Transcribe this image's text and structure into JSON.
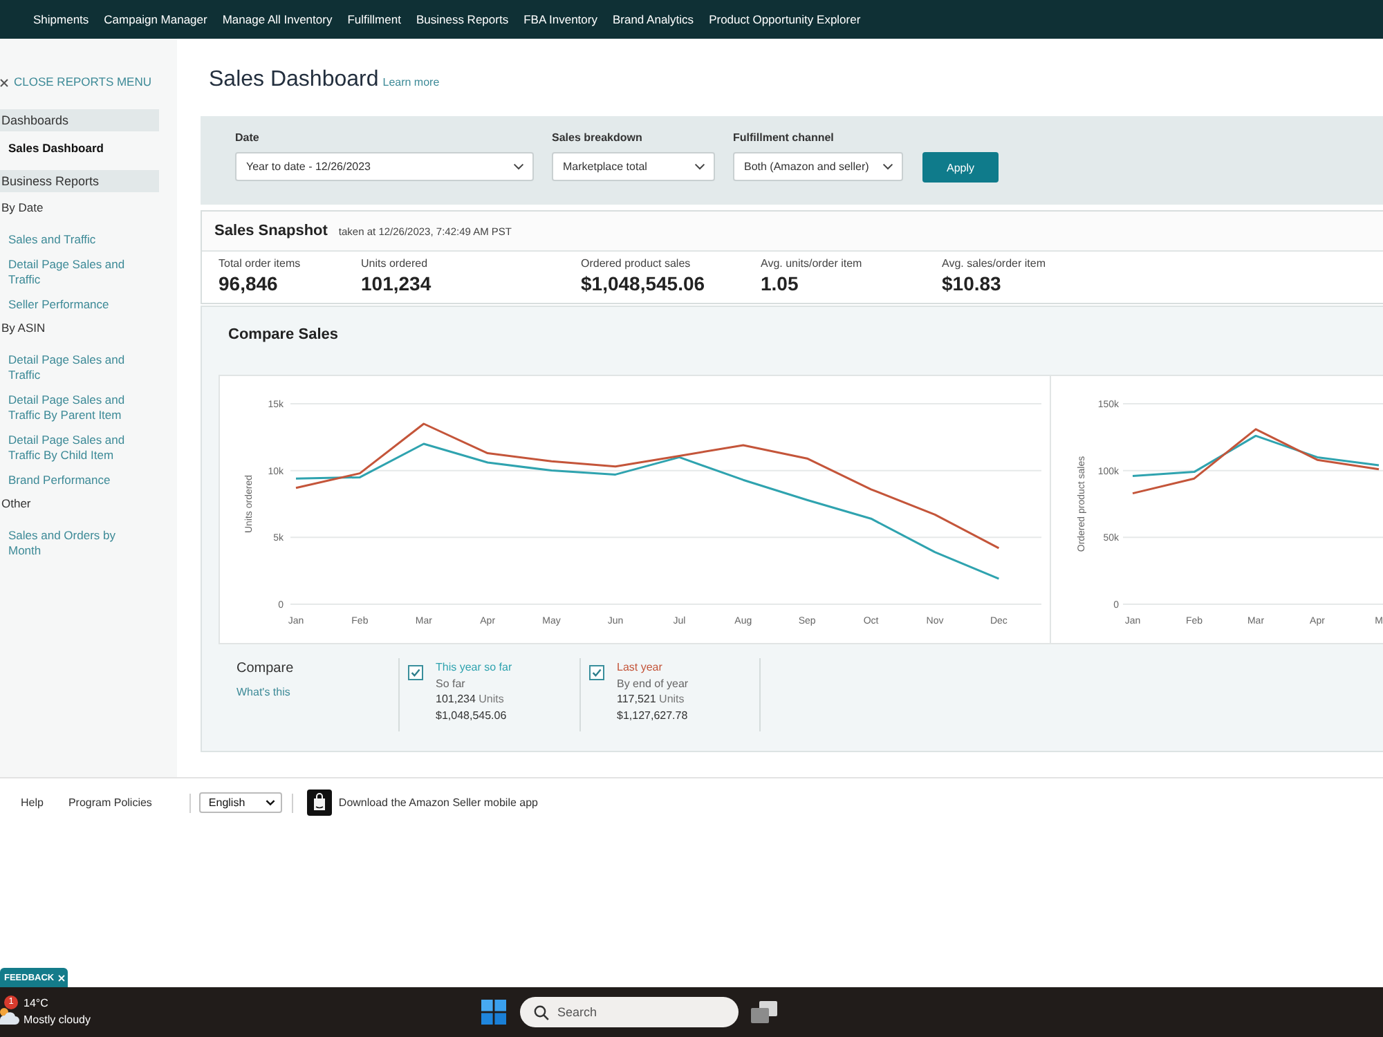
{
  "top_nav": {
    "items": [
      "Shipments",
      "Campaign Manager",
      "Manage All Inventory",
      "Fulfillment",
      "Business Reports",
      "FBA Inventory",
      "Brand Analytics",
      "Product Opportunity Explorer"
    ]
  },
  "sidebar": {
    "close_label": "CLOSE REPORTS MENU",
    "entries": [
      {
        "kind": "section",
        "label": "Dashboards"
      },
      {
        "kind": "link",
        "label": "Sales Dashboard",
        "selected": true
      },
      {
        "kind": "section",
        "label": "Business Reports"
      },
      {
        "kind": "group",
        "label": "By Date"
      },
      {
        "kind": "link",
        "label": "Sales and Traffic",
        "selected": false
      },
      {
        "kind": "link",
        "label": "Detail Page Sales and Traffic",
        "selected": false
      },
      {
        "kind": "link",
        "label": "Seller Performance",
        "selected": false
      },
      {
        "kind": "group",
        "label": "By ASIN"
      },
      {
        "kind": "link",
        "label": "Detail Page Sales and Traffic",
        "selected": false
      },
      {
        "kind": "link",
        "label": "Detail Page Sales and Traffic By Parent Item",
        "selected": false
      },
      {
        "kind": "link",
        "label": "Detail Page Sales and Traffic By Child Item",
        "selected": false
      },
      {
        "kind": "link",
        "label": "Brand Performance",
        "selected": false
      },
      {
        "kind": "group",
        "label": "Other"
      },
      {
        "kind": "link",
        "label": "Sales and Orders by Month",
        "selected": false
      }
    ]
  },
  "page": {
    "title": "Sales Dashboard",
    "learn_more": "Learn more"
  },
  "filters": {
    "fields": [
      {
        "label": "Date",
        "value": "Year to date - 12/26/2023"
      },
      {
        "label": "Sales breakdown",
        "value": "Marketplace total"
      },
      {
        "label": "Fulfillment channel",
        "value": "Both (Amazon and seller)"
      }
    ],
    "apply_button": "Apply"
  },
  "sales_snapshot": {
    "title": "Sales Snapshot",
    "taken_at": "taken at 12/26/2023, 7:42:49 AM PST",
    "metrics": [
      {
        "label": "Total order items",
        "value": "96,846"
      },
      {
        "label": "Units ordered",
        "value": "101,234"
      },
      {
        "label": "Ordered product sales",
        "value": "$1,048,545.06"
      },
      {
        "label": "Avg. units/order item",
        "value": "1.05"
      },
      {
        "label": "Avg. sales/order item",
        "value": "$10.83"
      }
    ]
  },
  "compare_sales": {
    "title": "Compare Sales",
    "charts": [
      {
        "chart_data": {
          "type": "line",
          "ylabel": "Units ordered",
          "categories": [
            "Jan",
            "Feb",
            "Mar",
            "Apr",
            "May",
            "Jun",
            "Jul",
            "Aug",
            "Sep",
            "Oct",
            "Nov",
            "Dec"
          ],
          "series": [
            {
              "color": "#2fa3af",
              "values": [
                9400,
                9500,
                12000,
                10600,
                10000,
                9700,
                11000,
                9300,
                7800,
                6400,
                3900,
                1900
              ]
            },
            {
              "color": "#c4553a",
              "values": [
                8700,
                9800,
                13500,
                11300,
                10700,
                10300,
                11100,
                11900,
                10900,
                8600,
                6700,
                4200
              ]
            }
          ],
          "ylim": [
            0,
            15000
          ],
          "yticks": [
            {
              "value": 0,
              "label": "0"
            },
            {
              "value": 5000,
              "label": "5k"
            },
            {
              "value": 10000,
              "label": "10k"
            },
            {
              "value": 15000,
              "label": "15k"
            }
          ]
        }
      },
      {
        "chart_data": {
          "type": "line",
          "ylabel": "Ordered product sales",
          "categories": [
            "Jan",
            "Feb",
            "Mar",
            "Apr",
            "M"
          ],
          "series": [
            {
              "color": "#2fa3af",
              "values": [
                96000,
                99000,
                126000,
                110000,
                104000
              ]
            },
            {
              "color": "#c4553a",
              "values": [
                83000,
                94000,
                131000,
                108000,
                101000
              ]
            }
          ],
          "ylim": [
            0,
            150000
          ],
          "yticks": [
            {
              "value": 0,
              "label": "0"
            },
            {
              "value": 50000,
              "label": "50k"
            },
            {
              "value": 100000,
              "label": "100k"
            },
            {
              "value": 150000,
              "label": "150k"
            }
          ]
        }
      }
    ],
    "compare": {
      "title": "Compare",
      "help_link": "What's this",
      "series": [
        {
          "checked": true,
          "color": "#2fa3af",
          "name": "This year so far",
          "period": "So far",
          "units": "101,234",
          "units_label": "Units",
          "sales": "$1,048,545.06"
        },
        {
          "checked": true,
          "color": "#c4553a",
          "name": "Last year",
          "period": "By end of year",
          "units": "117,521",
          "units_label": "Units",
          "sales": "$1,127,627.78"
        }
      ]
    }
  },
  "footer": {
    "links": [
      "Help",
      "Program Policies"
    ],
    "language": "English",
    "app_promo": "Download the Amazon Seller mobile app"
  },
  "feedback_tab": {
    "label": "FEEDBACK"
  },
  "taskbar": {
    "weather": {
      "badge": "1",
      "temperature": "14°C",
      "condition": "Mostly cloudy"
    },
    "search": {
      "placeholder": "Search"
    }
  }
}
